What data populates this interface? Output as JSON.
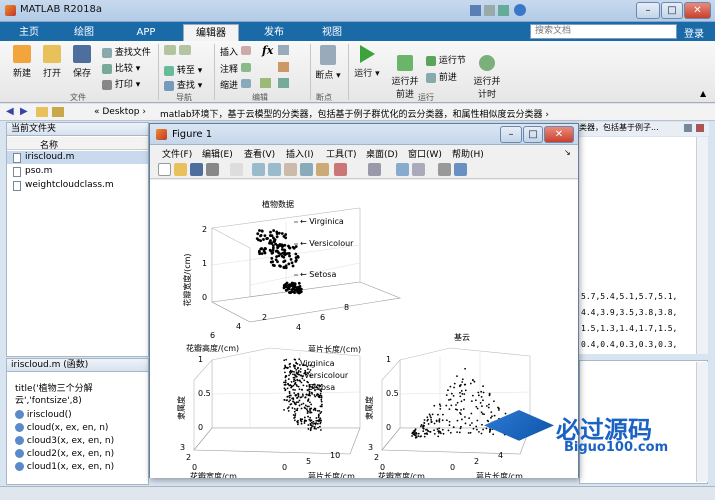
{
  "window": {
    "title": "MATLAB R2018a",
    "min": "–",
    "max": "□",
    "close": "✕"
  },
  "tabs": [
    {
      "label": "主页"
    },
    {
      "label": "绘图"
    },
    {
      "label": "APP"
    },
    {
      "label": "编辑器"
    },
    {
      "label": "发布"
    },
    {
      "label": "视图"
    }
  ],
  "search_placeholder": "搜索文档",
  "login_label": "登录",
  "ribbon": {
    "file": {
      "new": "新建",
      "open": "打开",
      "save": "保存",
      "find_files": "查找文件",
      "compare": "比较",
      "print": "打印",
      "group": "文件"
    },
    "nav": {
      "goto": "转至",
      "find": "查找",
      "group": "导航"
    },
    "edit": {
      "insert": "插入",
      "comment": "注释",
      "indent": "缩进",
      "fx": "fx",
      "group": "编辑"
    },
    "breakpoints": {
      "label": "断点",
      "group": "断点"
    },
    "run": {
      "run": "运行",
      "run_advance": "运行并\n前进",
      "run_section": "运行节",
      "advance": "前进",
      "run_time": "运行并\n计时",
      "group": "运行"
    }
  },
  "address": {
    "path_prefix": "« Desktop ›",
    "path": "matlab环境下，基于云模型的分类器，包括基于例子群优化的云分类器，和属性相似度云分类器 ›"
  },
  "current_folder": {
    "header": "当前文件夹",
    "column_name": "名称",
    "files": [
      {
        "name": "iriscloud.m"
      },
      {
        "name": "pso.m"
      },
      {
        "name": "weightcloudclass.m"
      }
    ]
  },
  "details": {
    "header": "iriscloud.m  (函数)",
    "line1": "title('植物三个分解",
    "line2": "云','fontsize',8)",
    "functions": [
      "iriscloud()",
      "cloud(x, ex, en, n)",
      "cloud3(x, ex, en, n)",
      "cloud2(x, ex, en, n)",
      "cloud1(x, ex, en, n)"
    ]
  },
  "figure": {
    "title": "Figure 1",
    "menus": [
      "文件(F)",
      "编辑(E)",
      "查看(V)",
      "插入(I)",
      "工具(T)",
      "桌面(D)",
      "窗口(W)",
      "帮助(H)"
    ]
  },
  "plot_top": {
    "title": "植物数据",
    "zlabel": "花瓣宽度/(cm)",
    "xlabel": "花瓣高度/(cm)",
    "ylabel": "萼片长度/(cm)",
    "zticks": [
      "2",
      "1",
      "0"
    ],
    "xticks": [
      "6",
      "4",
      "2"
    ],
    "yticks": [
      "4",
      "6",
      "8"
    ],
    "labels": [
      "Virginica",
      "Versicolour",
      "Setosa"
    ]
  },
  "plot_bl": {
    "zlabel": "隶属度",
    "xlabel": "花瓣宽度/cm",
    "ylabel": "萼片长度/cm",
    "zticks": [
      "1",
      "0.5",
      "0"
    ],
    "xticks": [
      "3",
      "2",
      "0"
    ],
    "yticks": [
      "0",
      "5",
      "10"
    ],
    "labels": [
      "Virginica",
      "Versicolour",
      "Setosa"
    ]
  },
  "plot_br": {
    "title": "基云",
    "zlabel": "隶属度",
    "xlabel": "花瓣宽度/cm",
    "ylabel": "萼片长度/cm",
    "zticks": [
      "1",
      "0.5",
      "0"
    ],
    "xticks": [
      "3",
      "2",
      "0"
    ],
    "yticks": [
      "0",
      "2",
      "4"
    ]
  },
  "editor_right": {
    "title_tail": "类器，包括基于例子...",
    "rows": [
      "5.7,5.4,5.1,5.7,5.1,",
      "4.4,3.9,3.5,3.8,3.8,",
      "1.5,1.3,1.4,1.7,1.5,",
      "0.4,0.4,0.3,0.3,0.3,"
    ]
  },
  "watermark": {
    "cn": "必过源码",
    "en": "Biguo100.com"
  }
}
